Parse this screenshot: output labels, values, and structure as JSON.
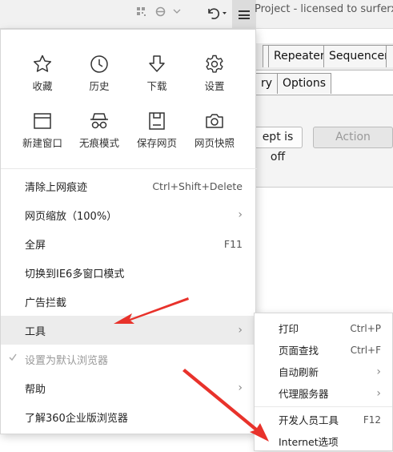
{
  "window_title": "Project - licensed to surferx",
  "burp": {
    "tabs": [
      "Repeater",
      "Sequencer"
    ],
    "subtabs": [
      "ry",
      "Options"
    ],
    "intercept_button": "ept is off",
    "action_button": "Action"
  },
  "quick_actions": [
    {
      "label": "收藏",
      "icon": "star-icon"
    },
    {
      "label": "历史",
      "icon": "clock-icon"
    },
    {
      "label": "下载",
      "icon": "download-icon"
    },
    {
      "label": "设置",
      "icon": "gear-icon"
    },
    {
      "label": "新建窗口",
      "icon": "window-icon"
    },
    {
      "label": "无痕模式",
      "icon": "incognito-icon"
    },
    {
      "label": "保存网页",
      "icon": "save-icon"
    },
    {
      "label": "网页快照",
      "icon": "camera-icon"
    }
  ],
  "menu_items": [
    {
      "label": "清除上网痕迹",
      "shortcut": "Ctrl+Shift+Delete"
    },
    {
      "label": "网页缩放（100%）",
      "shortcut": ""
    },
    {
      "label": "全屏",
      "shortcut": "F11"
    },
    {
      "label": "切换到IE6多窗口模式",
      "shortcut": ""
    },
    {
      "label": "广告拦截",
      "shortcut": ""
    },
    {
      "label": "工具",
      "shortcut": ""
    },
    {
      "label": "设置为默认浏览器",
      "shortcut": ""
    },
    {
      "label": "帮助",
      "shortcut": ""
    },
    {
      "label": "了解360企业版浏览器",
      "shortcut": ""
    }
  ],
  "tools_submenu": [
    {
      "label": "打印",
      "shortcut": "Ctrl+P"
    },
    {
      "label": "页面查找",
      "shortcut": "Ctrl+F"
    },
    {
      "label": "自动刷新",
      "shortcut": ""
    },
    {
      "label": "代理服务器",
      "shortcut": ""
    },
    {
      "label": "开发人员工具",
      "shortcut": "F12"
    },
    {
      "label": "Internet选项",
      "shortcut": ""
    }
  ],
  "colors": {
    "annotation_red": "#e8322b",
    "hover_bg": "#ececec",
    "menu_bg": "#ffffff"
  }
}
